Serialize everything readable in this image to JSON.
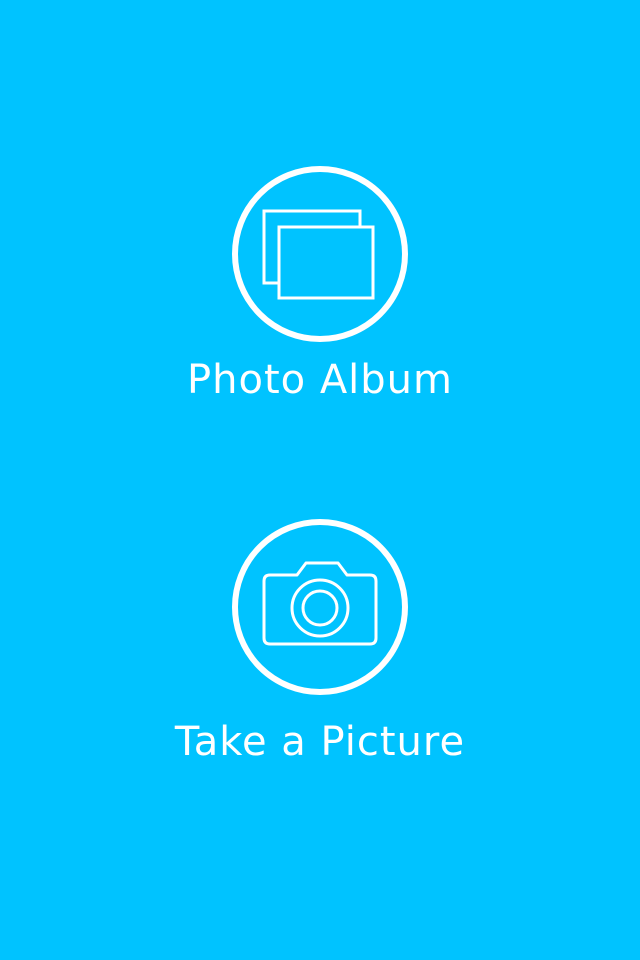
{
  "colors": {
    "background": "#00c3ff",
    "foreground": "#ffffff"
  },
  "options": [
    {
      "label": "Photo Album",
      "icon": "photo-album-icon"
    },
    {
      "label": "Take a Picture",
      "icon": "camera-icon"
    }
  ]
}
